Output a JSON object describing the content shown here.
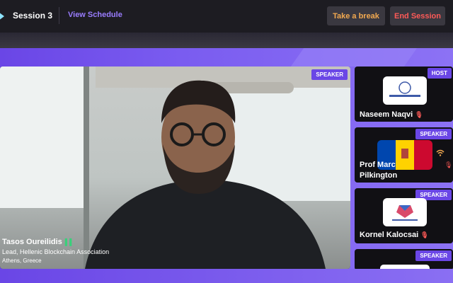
{
  "header": {
    "session_title": "Session 3",
    "view_schedule_label": "View Schedule",
    "take_break_label": "Take a break",
    "end_session_label": "End Session"
  },
  "main_speaker": {
    "badge": "SPEAKER",
    "name": "Tasos Oureilidis",
    "role": "Lead, Hellenic Blockchain Association",
    "location": "Athens, Greece"
  },
  "tiles": [
    {
      "badge": "HOST",
      "name": "Naseem Naqvi",
      "logo_text": "The British Blockchain Association"
    },
    {
      "badge": "SPEAKER",
      "name_line1": "Prof Marc",
      "name_line2": "Pilkington"
    },
    {
      "badge": "SPEAKER",
      "name": "Kornel Kalocsai",
      "logo_text": "Blockchain Hungary Association"
    },
    {
      "badge": "SPEAKER"
    }
  ],
  "colors": {
    "accent": "#6a46e6",
    "break_text": "#f2a950",
    "end_text": "#ff5a57",
    "mic_on": "#38d17a"
  }
}
